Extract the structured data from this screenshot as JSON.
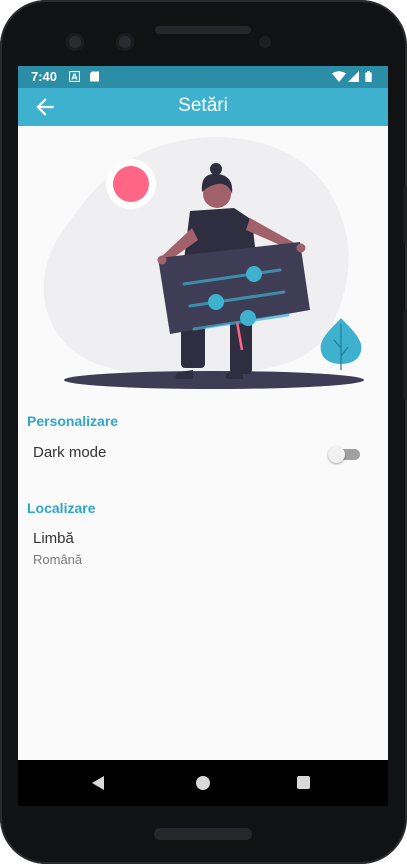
{
  "status_bar": {
    "time": "7:40",
    "icons": [
      "a-notification-icon",
      "sd-card-icon",
      "wifi-icon",
      "signal-icon",
      "battery-icon"
    ]
  },
  "app_bar": {
    "title": "Setări",
    "back_icon": "arrow-back-icon"
  },
  "sections": {
    "personalize": {
      "header": "Personalizare",
      "dark_mode": {
        "label": "Dark mode",
        "enabled": false
      }
    },
    "localization": {
      "header": "Localizare",
      "language": {
        "label": "Limbă",
        "value": "Română"
      }
    }
  },
  "nav_bar": {
    "icons": [
      "nav-back-icon",
      "nav-home-icon",
      "nav-recents-icon"
    ]
  },
  "colors": {
    "status_bar": "#2b8ea6",
    "app_bar": "#3eb1cf",
    "section_header": "#2da7c9",
    "accent_pink": "#ff6584",
    "illustration_dark": "#3f3d56"
  }
}
